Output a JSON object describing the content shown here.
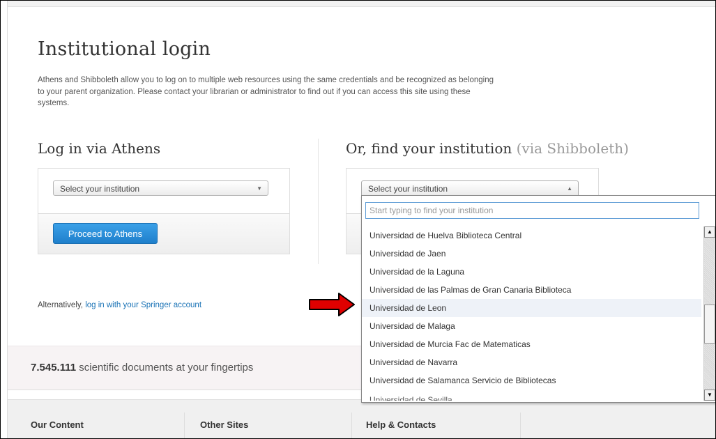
{
  "page": {
    "title": "Institutional login",
    "intro": "Athens and Shibboleth allow you to log on to multiple web resources using the same credentials and be recognized as belonging to your parent organization. Please contact your librarian or administrator to find out if you can access this site using these systems."
  },
  "athens": {
    "heading": "Log in via Athens",
    "select_placeholder": "Select your institution",
    "button_label": "Proceed to Athens"
  },
  "shibboleth": {
    "heading": "Or, find your institution",
    "heading_suffix": "(via Shibboleth)",
    "select_placeholder": "Select your institution",
    "search_placeholder": "Start typing to find your institution",
    "options": [
      "Universidad de Huelva Biblioteca Central",
      "Universidad de Jaen",
      "Universidad de la Laguna",
      "Universidad de las Palmas de Gran Canaria Biblioteca",
      "Universidad de Leon",
      "Universidad de Malaga",
      "Universidad de Murcia Fac de Matematicas",
      "Universidad de Navarra",
      "Universidad de Salamanca Servicio de Bibliotecas",
      "Universidad de Sevilla"
    ],
    "highlighted_option": "Universidad de Leon"
  },
  "alternative": {
    "prefix": "Alternatively,",
    "link_text": "log in with your Springer account"
  },
  "stats": {
    "count": "7.545.111",
    "text": "scientific documents at your fingertips"
  },
  "footer": {
    "columns": [
      "Our Content",
      "Other Sites",
      "Help & Contacts"
    ]
  },
  "colors": {
    "primary_button": "#2a8cd8",
    "link": "#1a73b6",
    "arrow": "#e00000",
    "highlight_row": "#eef2f8"
  },
  "icons": {
    "select_caret": "triangle-down",
    "shib_caret": "triangle-up",
    "annotation": "red-arrow-right"
  }
}
